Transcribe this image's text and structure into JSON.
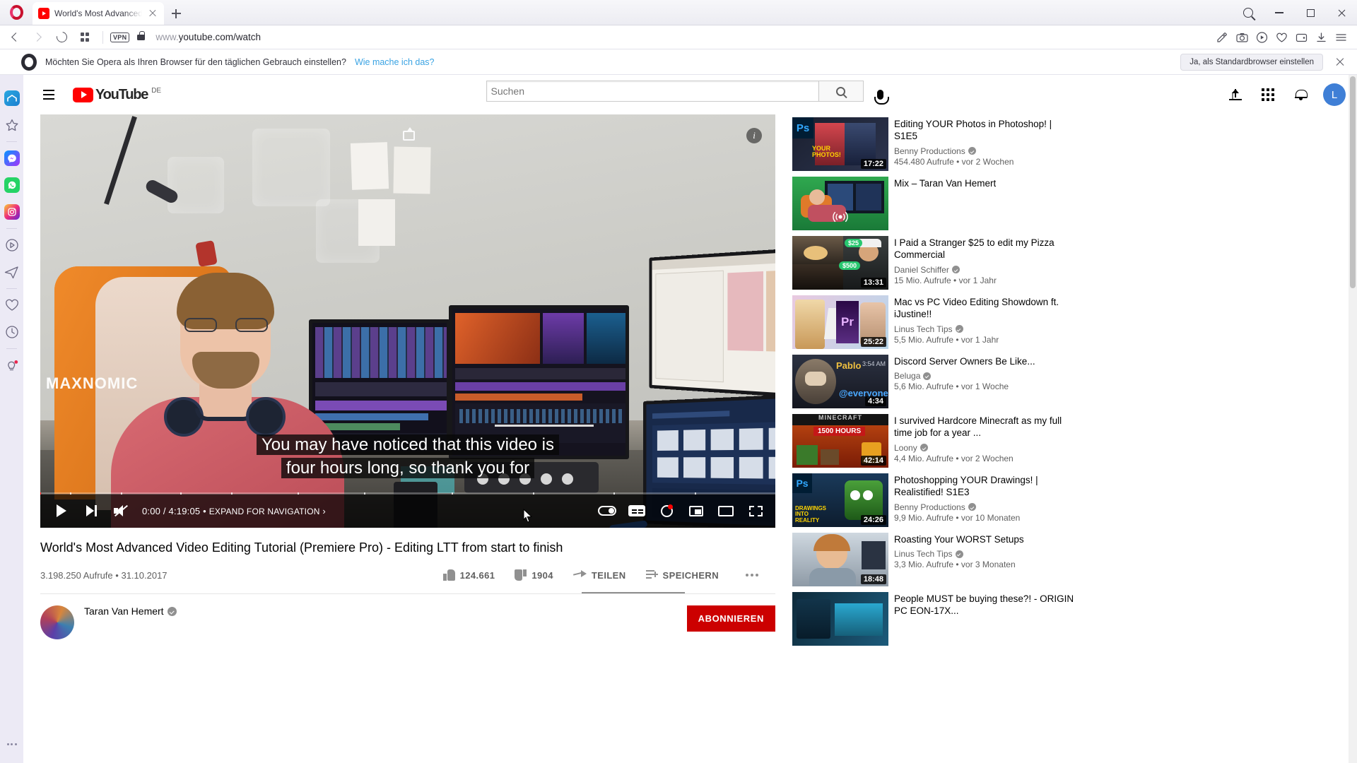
{
  "browser": {
    "tab": {
      "title": "World's Most Advanced Vi",
      "favicon": "youtube-icon"
    },
    "newtab_label": "+",
    "url_prefix": "www.",
    "url_domain": "youtube.com",
    "url_path": "/watch",
    "vpn_badge": "VPN",
    "window_controls": {
      "search": "search-icon",
      "minimize": "minimize-icon",
      "maximize": "maximize-icon",
      "close": "close-icon"
    }
  },
  "notification": {
    "text": "Möchten Sie Opera als Ihren Browser für den täglichen Gebrauch einstellen?",
    "link": "Wie mache ich das?",
    "button": "Ja, als Standardbrowser einstellen"
  },
  "sidebar": {
    "items": [
      {
        "name": "opera-workspace-icon",
        "label": ""
      },
      {
        "name": "favorites-star-icon",
        "label": ""
      },
      {
        "name": "messenger-icon",
        "label": ""
      },
      {
        "name": "whatsapp-icon",
        "label": ""
      },
      {
        "name": "instagram-icon",
        "label": ""
      },
      {
        "name": "player-icon",
        "label": ""
      },
      {
        "name": "telegram-icon",
        "label": ""
      },
      {
        "name": "heart-icon",
        "label": ""
      },
      {
        "name": "history-clock-icon",
        "label": ""
      },
      {
        "name": "tips-bulb-icon",
        "label": ""
      }
    ]
  },
  "youtube": {
    "logo_word": "YouTube",
    "country_code": "DE",
    "search": {
      "value": "",
      "placeholder": "Suchen"
    },
    "avatar_letter": "L",
    "player": {
      "current_time": "0:00",
      "duration": "4:19:05",
      "separator": "•",
      "expand_label": "EXPAND FOR NAVIGATION",
      "chevron": "›",
      "caption_line1": "You may have noticed that this video is",
      "caption_line2": "four hours long, so thank you for"
    },
    "video": {
      "title": "World's Most Advanced Video Editing Tutorial (Premiere Pro) - Editing LTT from start to finish",
      "views": "3.198.250 Aufrufe",
      "meta_separator": "•",
      "date": "31.10.2017",
      "likes": "124.661",
      "dislikes": "1904",
      "share_label": "TEILEN",
      "save_label": "SPEICHERN"
    },
    "channel": {
      "name": "Taran Van Hemert",
      "subscribe_label": "ABONNIEREN"
    },
    "recommendations": [
      {
        "title": "Editing YOUR Photos in Photoshop! | S1E5",
        "channel": "Benny Productions",
        "verified": true,
        "stats": "454.480 Aufrufe • vor 2 Wochen",
        "duration": "17:22",
        "thumb_style": "photoshop",
        "thumb_text": "YOUR PHOTOS!"
      },
      {
        "title": "Mix – Taran Van Hemert",
        "channel": "",
        "verified": false,
        "stats": "",
        "duration": "",
        "thumb_style": "mix-live",
        "thumb_text": ""
      },
      {
        "title": "I Paid a Stranger $25 to edit my Pizza Commercial",
        "channel": "Daniel Schiffer",
        "verified": true,
        "stats": "15 Mio. Aufrufe • vor 1 Jahr",
        "duration": "13:31",
        "thumb_style": "pizza",
        "thumb_text": "$25"
      },
      {
        "title": "Mac vs PC Video Editing Showdown ft. iJustine!!",
        "channel": "Linus Tech Tips",
        "verified": true,
        "stats": "5,5 Mio. Aufrufe • vor 1 Jahr",
        "duration": "25:22",
        "thumb_style": "macvspc",
        "thumb_text": "Pr"
      },
      {
        "title": "Discord Server Owners Be Like...",
        "channel": "Beluga",
        "verified": true,
        "stats": "5,6 Mio. Aufrufe • vor 1 Woche",
        "duration": "4:34",
        "thumb_style": "discord",
        "thumb_text": "@everyone"
      },
      {
        "title": "I survived Hardcore Minecraft as my full time job for a year ...",
        "channel": "Loony",
        "verified": true,
        "stats": "4,4 Mio. Aufrufe • vor 2 Wochen",
        "duration": "42:14",
        "thumb_style": "minecraft",
        "thumb_text": "1500 HOURS"
      },
      {
        "title": "Photoshopping YOUR Drawings! | Realistified! S1E3",
        "channel": "Benny Productions",
        "verified": true,
        "stats": "9,9 Mio. Aufrufe • vor 10 Monaten",
        "duration": "24:26",
        "thumb_style": "drawings",
        "thumb_text": "DRAWINGS INTO REALITY"
      },
      {
        "title": "Roasting Your WORST Setups",
        "channel": "Linus Tech Tips",
        "verified": true,
        "stats": "3,3 Mio. Aufrufe • vor 3 Monaten",
        "duration": "18:48",
        "thumb_style": "setups",
        "thumb_text": ""
      },
      {
        "title": "People MUST be buying these?! - ORIGIN PC EON-17X...",
        "channel": "",
        "verified": false,
        "stats": "",
        "duration": "",
        "thumb_style": "originpc",
        "thumb_text": ""
      }
    ]
  },
  "colors": {
    "youtube_red": "#ff0000",
    "subscribe_red": "#cc0000",
    "link_blue": "#3aa3e3",
    "opera_red": "#c8102e"
  }
}
